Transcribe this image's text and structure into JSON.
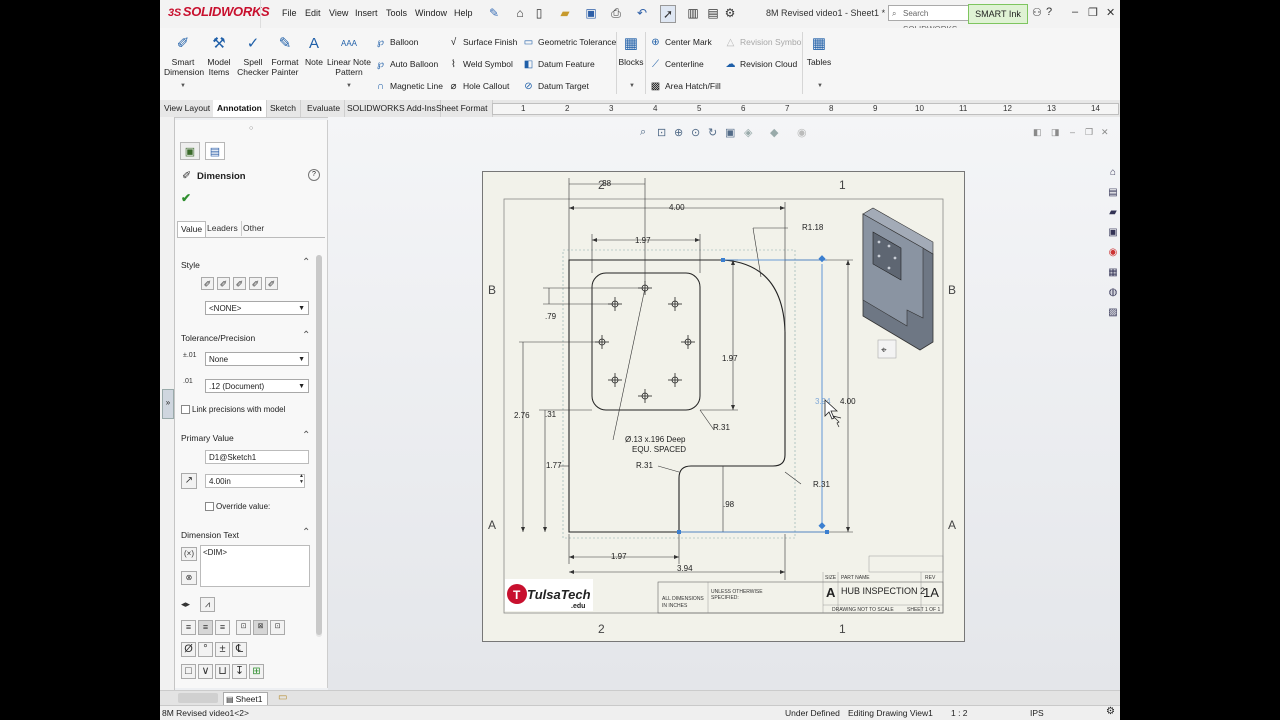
{
  "app": {
    "brand": "SOLIDWORKS",
    "brand_mark": "3S",
    "document_title": "8M Revised video1 - Sheet1 *",
    "menu": [
      "File",
      "Edit",
      "View",
      "Insert",
      "Tools",
      "Window",
      "Help"
    ],
    "search_placeholder": "Search SOLIDWORKS",
    "smart_ink": "SMART Ink",
    "help": "?"
  },
  "ribbon": {
    "big_buttons": [
      {
        "label1": "Smart",
        "label2": "Dimension"
      },
      {
        "label1": "Model",
        "label2": "Items"
      },
      {
        "label1": "Spell",
        "label2": "Checker"
      },
      {
        "label1": "Format",
        "label2": "Painter"
      },
      {
        "label1": "Note",
        "label2": ""
      },
      {
        "label1": "Linear Note",
        "label2": "Pattern"
      }
    ],
    "col1": [
      "Balloon",
      "Auto Balloon",
      "Magnetic Line"
    ],
    "col2": [
      "Surface Finish",
      "Weld Symbol",
      "Hole Callout"
    ],
    "col3": [
      "Geometric Tolerance",
      "Datum Feature",
      "Datum Target"
    ],
    "blocks": "Blocks",
    "col4": [
      "Center Mark",
      "Centerline",
      "Area Hatch/Fill"
    ],
    "col5": [
      "Revision Symbol",
      "Revision Cloud"
    ],
    "tables": "Tables"
  },
  "command_tabs": [
    "View Layout",
    "Annotation",
    "Sketch",
    "Evaluate",
    "SOLIDWORKS Add-Ins",
    "Sheet Format"
  ],
  "ruler_numbers": [
    "1",
    "2",
    "3",
    "4",
    "5",
    "6",
    "7",
    "8",
    "9",
    "10",
    "11",
    "12",
    "13",
    "14"
  ],
  "property_manager": {
    "title": "Dimension",
    "subtabs": [
      "Value",
      "Leaders",
      "Other"
    ],
    "style": {
      "header": "Style",
      "value": "<NONE>"
    },
    "tolerance": {
      "header": "Tolerance/Precision",
      "type": "None",
      "precision": ".12 (Document)",
      "link_label": "Link precisions with model"
    },
    "primary_value": {
      "header": "Primary Value",
      "name": "D1@Sketch1",
      "value": "4.00in",
      "override_label": "Override value:"
    },
    "dimension_text": {
      "header": "Dimension Text",
      "text": "<DIM>"
    },
    "symbols_row1": [
      "Ø",
      "°",
      "±",
      "℄"
    ],
    "symbols_row2": [
      "□",
      "∨",
      "⊔",
      "↧"
    ]
  },
  "drawing": {
    "zone_cols": [
      "2",
      "1"
    ],
    "zone_rows": [
      "B",
      "A"
    ],
    "dims": {
      "d_38": ".38",
      "d_400_top": "4.00",
      "d_197_top": "1.97",
      "d_r118": "R1.18",
      "d_79": ".79",
      "d_197_mid": "1.97",
      "d_276": "2.76",
      "d_31": ".31",
      "d_177": "1.77",
      "d_r31_a": "R.31",
      "d_r31_b": "R.31",
      "d_r31_c": "R.31",
      "d_98": ".98",
      "d_394_sel": "3.94",
      "d_400_right": "4.00",
      "d_197_bot": "1.97",
      "d_394_bot": "3.94"
    },
    "hole_note_1": "Ø.13 x.196 Deep",
    "hole_note_2": "EQU. SPACED",
    "title_block": {
      "school": "TulsaTech",
      "school_suffix": ".edu",
      "dims_note_1": "ALL DIMENSIONS",
      "dims_note_2": "IN INCHES",
      "unless_1": "UNLESS OTHERWISE",
      "unless_2": "SPECIFIED:",
      "size_label": "SIZE",
      "size": "A",
      "part_label": "PART NAME",
      "part_name": "HUB INSPECTION 2",
      "rev_label": "REV",
      "rev": "1A",
      "dwg": "DRAWING NOT TO SCALE",
      "sheet": "SHEET 1 OF 1"
    }
  },
  "sheet_tab": "Sheet1",
  "status": {
    "file": "8M Revised video1<2>",
    "defined": "Under Defined",
    "editing": "Editing Drawing View1",
    "scale": "1 : 2",
    "units": "IPS"
  }
}
